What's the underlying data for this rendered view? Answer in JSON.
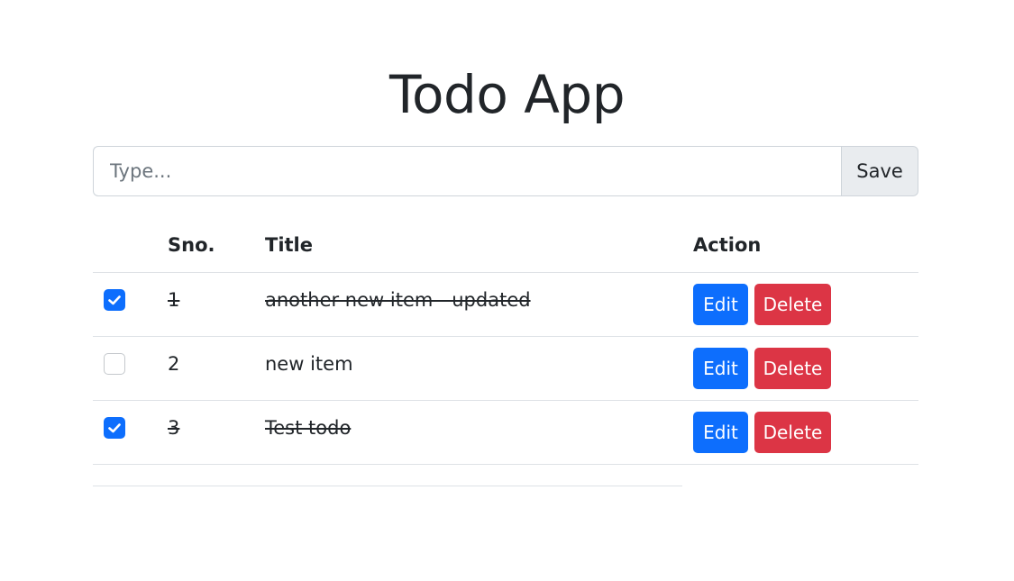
{
  "app": {
    "title": "Todo App"
  },
  "form": {
    "input_value": "",
    "input_placeholder": "Type...",
    "save_label": "Save"
  },
  "table": {
    "headers": {
      "sno": "Sno.",
      "title": "Title",
      "action": "Action"
    },
    "rows": [
      {
        "sno": "1",
        "title": "another new item - updated",
        "done": true,
        "edit_label": "Edit",
        "delete_label": "Delete"
      },
      {
        "sno": "2",
        "title": "new item",
        "done": false,
        "edit_label": "Edit",
        "delete_label": "Delete"
      },
      {
        "sno": "3",
        "title": "Test todo",
        "done": true,
        "edit_label": "Edit",
        "delete_label": "Delete"
      }
    ]
  },
  "colors": {
    "primary": "#0d6efd",
    "danger": "#dc3545",
    "save_bg": "#e9ecef"
  }
}
